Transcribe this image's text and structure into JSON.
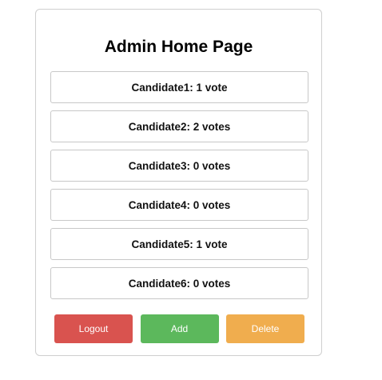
{
  "page": {
    "title": "Admin Home Page"
  },
  "candidates": [
    {
      "label": "Candidate1: 1 vote"
    },
    {
      "label": "Candidate2: 2 votes"
    },
    {
      "label": "Candidate3: 0 votes"
    },
    {
      "label": "Candidate4: 0 votes"
    },
    {
      "label": "Candidate5: 1 vote"
    },
    {
      "label": "Candidate6: 0 votes"
    }
  ],
  "actions": {
    "logout_label": "Logout",
    "add_label": "Add",
    "delete_label": "Delete"
  },
  "colors": {
    "logout": "#d9534f",
    "add": "#5cb85c",
    "delete": "#f0ad4e"
  }
}
